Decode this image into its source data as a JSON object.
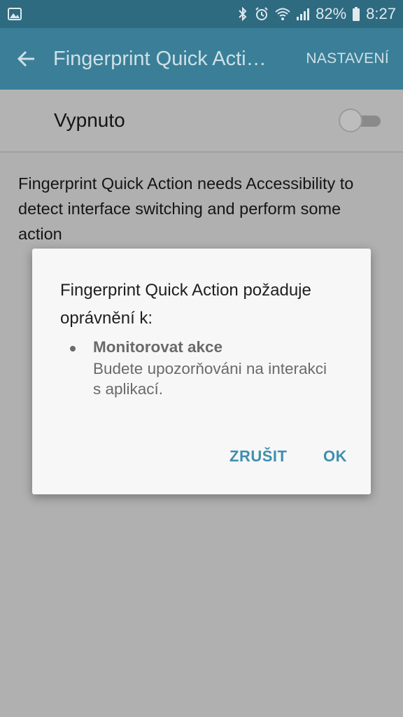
{
  "status_bar": {
    "battery": "82%",
    "time": "8:27",
    "icons": [
      "image-notification-icon",
      "bluetooth-icon",
      "alarm-icon",
      "wifi-icon",
      "signal-icon",
      "battery-icon"
    ]
  },
  "app_bar": {
    "title": "Fingerprint Quick Acti…",
    "action": "NASTAVENÍ",
    "back_icon": "arrow-left-icon"
  },
  "toggle": {
    "label": "Vypnuto",
    "state": "off"
  },
  "description": "Fingerprint Quick Action needs Accessibility to detect interface switching and perform some action",
  "dialog": {
    "title": "Fingerprint Quick Action požaduje oprávnění k:",
    "permission_name": "Monitorovat akce",
    "permission_desc": "Budete upozorňováni na interakci s aplikací.",
    "cancel_label": "ZRUŠIT",
    "ok_label": "OK"
  },
  "colors": {
    "status_bar": "#2e6a80",
    "app_bar": "#3a7f97",
    "accent": "#3f8fad",
    "scrim_background": "#b0b0b0"
  }
}
